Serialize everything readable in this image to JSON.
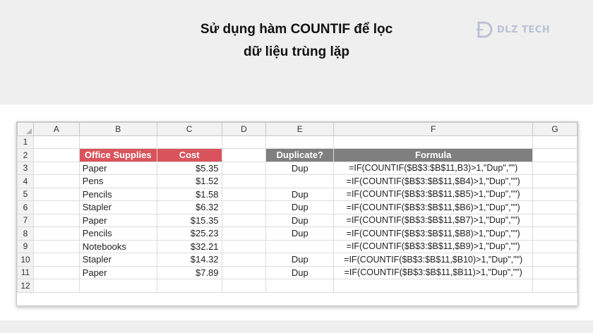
{
  "header": {
    "title_line1": "Sử dụng hàm COUNTIF để lọc",
    "title_line2": "dữ liệu trùng lặp",
    "logo_text": "DLZ TECH"
  },
  "spreadsheet": {
    "columns": [
      "A",
      "B",
      "C",
      "D",
      "E",
      "F",
      "G"
    ],
    "row_numbers": [
      "1",
      "2",
      "3",
      "4",
      "5",
      "6",
      "7",
      "8",
      "9",
      "10",
      "11",
      "12"
    ],
    "headers": {
      "office_supplies": "Office Supplies",
      "cost": "Cost",
      "duplicate": "Duplicate?",
      "formula": "Formula"
    },
    "header_colors": {
      "red": "#d9535c",
      "gray": "#7f7f7f"
    },
    "rows": [
      {
        "item": "Paper",
        "cost": "$5.35",
        "dup": "Dup",
        "formula": "=IF(COUNTIF($B$3:$B$11,B3)>1,\"Dup\",\"\")"
      },
      {
        "item": "Pens",
        "cost": "$1.52",
        "dup": "",
        "formula": "=IF(COUNTIF($B$3:$B$11,$B4)>1,\"Dup\",\"\")"
      },
      {
        "item": "Pencils",
        "cost": "$1.58",
        "dup": "Dup",
        "formula": "=IF(COUNTIF($B$3:$B$11,$B5)>1,\"Dup\",\"\")"
      },
      {
        "item": "Stapler",
        "cost": "$6.32",
        "dup": "Dup",
        "formula": "=IF(COUNTIF($B$3:$B$11,$B6)>1,\"Dup\",\"\")"
      },
      {
        "item": "Paper",
        "cost": "$15.35",
        "dup": "Dup",
        "formula": "=IF(COUNTIF($B$3:$B$11,$B7)>1,\"Dup\",\"\")"
      },
      {
        "item": "Pencils",
        "cost": "$25.23",
        "dup": "Dup",
        "formula": "=IF(COUNTIF($B$3:$B$11,$B8)>1,\"Dup\",\"\")"
      },
      {
        "item": "Notebooks",
        "cost": "$32.21",
        "dup": "",
        "formula": "=IF(COUNTIF($B$3:$B$11,$B9)>1,\"Dup\",\"\")"
      },
      {
        "item": "Stapler",
        "cost": "$14.32",
        "dup": "Dup",
        "formula": "=IF(COUNTIF($B$3:$B$11,$B10)>1,\"Dup\",\"\")"
      },
      {
        "item": "Paper",
        "cost": "$7.89",
        "dup": "Dup",
        "formula": "=IF(COUNTIF($B$3:$B$11,$B11)>1,\"Dup\",\"\")"
      }
    ]
  }
}
